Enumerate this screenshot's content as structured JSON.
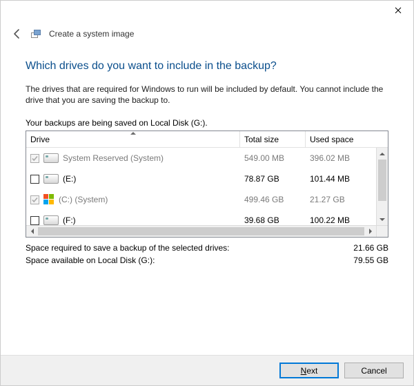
{
  "window": {
    "title": "Create a system image"
  },
  "page": {
    "heading": "Which drives do you want to include in the backup?",
    "description": "The drives that are required for Windows to run will be included by default. You cannot include the drive that you are saving the backup to.",
    "save_location_line": "Your backups are being saved on Local Disk (G:)."
  },
  "grid": {
    "columns": {
      "drive": "Drive",
      "total": "Total size",
      "used": "Used space"
    },
    "rows": [
      {
        "checked": true,
        "required": true,
        "icon": "disk",
        "label": "System Reserved (System)",
        "total": "549.00 MB",
        "used": "396.02 MB"
      },
      {
        "checked": false,
        "required": false,
        "icon": "disk",
        "label": "(E:)",
        "total": "78.87 GB",
        "used": "101.44 MB"
      },
      {
        "checked": true,
        "required": true,
        "icon": "windows",
        "label": "(C:) (System)",
        "total": "499.46 GB",
        "used": "21.27 GB"
      },
      {
        "checked": false,
        "required": false,
        "icon": "disk",
        "label": "(F:)",
        "total": "39.68 GB",
        "used": "100.22 MB"
      }
    ]
  },
  "summary": {
    "required_label": "Space required to save a backup of the selected drives:",
    "required_value": "21.66 GB",
    "available_label": "Space available on Local Disk (G:):",
    "available_value": "79.55 GB"
  },
  "buttons": {
    "next_prefix": "N",
    "next_rest": "ext",
    "cancel": "Cancel"
  }
}
